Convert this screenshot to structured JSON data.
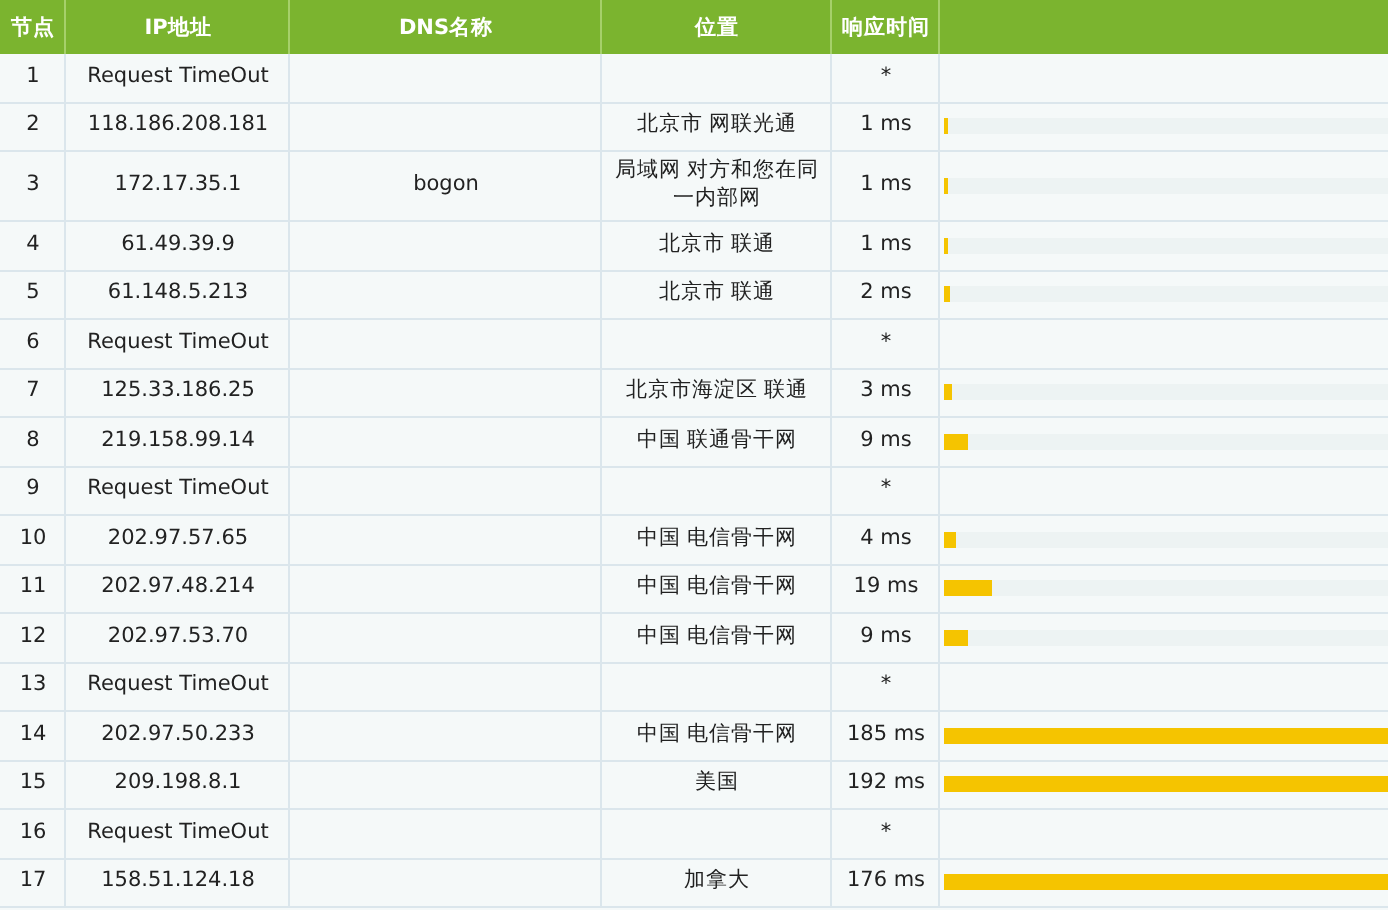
{
  "table": {
    "columns": [
      "节点",
      "IP地址",
      "DNS名称",
      "位置",
      "响应时间"
    ],
    "rows": [
      {
        "hop": "1",
        "ip": "Request TimeOut",
        "time": "*"
      },
      {
        "hop": "2",
        "ip": "118.186.208.181",
        "location": "北京市 网联光通",
        "time": "1 ms",
        "level": 0.01
      },
      {
        "hop": "3",
        "ip": "172.17.35.1",
        "dns": "bogon",
        "location": "局域网 对方和您在同一内部网",
        "time": "1 ms",
        "level": 0.01
      },
      {
        "hop": "4",
        "ip": "61.49.39.9",
        "location": "北京市 联通",
        "time": "1 ms",
        "level": 0.01
      },
      {
        "hop": "5",
        "ip": "61.148.5.213",
        "location": "北京市 联通",
        "time": "2 ms",
        "level": 0.014
      },
      {
        "hop": "6",
        "ip": "Request TimeOut",
        "time": "*"
      },
      {
        "hop": "7",
        "ip": "125.33.186.25",
        "location": "北京市海淀区 联通",
        "time": "3 ms",
        "level": 0.02
      },
      {
        "hop": "8",
        "ip": "219.158.99.14",
        "location": "中国 联通骨干网",
        "time": "9 ms",
        "level": 0.054
      },
      {
        "hop": "9",
        "ip": "Request TimeOut",
        "time": "*"
      },
      {
        "hop": "10",
        "ip": "202.97.57.65",
        "location": "中国 电信骨干网",
        "time": "4 ms",
        "level": 0.025
      },
      {
        "hop": "11",
        "ip": "202.97.48.214",
        "location": "中国 电信骨干网",
        "time": "19 ms",
        "level": 0.11
      },
      {
        "hop": "12",
        "ip": "202.97.53.70",
        "location": "中国 电信骨干网",
        "time": "9 ms",
        "level": 0.054
      },
      {
        "hop": "13",
        "ip": "Request TimeOut",
        "time": "*"
      },
      {
        "hop": "14",
        "ip": "202.97.50.233",
        "location": "中国 电信骨干网",
        "time": "185 ms",
        "level": 1
      },
      {
        "hop": "15",
        "ip": "209.198.8.1",
        "location": "美国",
        "time": "192 ms",
        "level": 1
      },
      {
        "hop": "16",
        "ip": "Request TimeOut",
        "time": "*"
      },
      {
        "hop": "17",
        "ip": "158.51.124.18",
        "location": "加拿大",
        "time": "176 ms",
        "level": 1
      }
    ]
  }
}
